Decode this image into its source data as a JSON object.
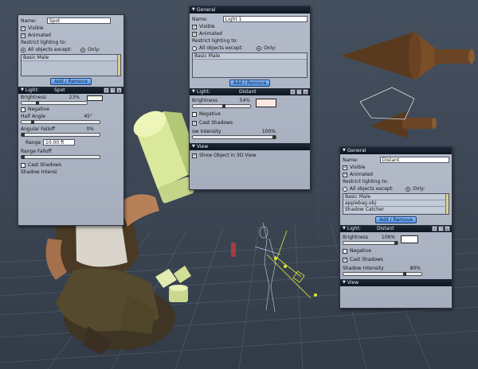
{
  "viewport": {
    "background": "#3e4856"
  },
  "spot_panel": {
    "name_label": "Name:",
    "name_value": "Spot",
    "visible_label": "Visible",
    "animated_label": "Animated",
    "restrict_label": "Restrict lighting to:",
    "all_except_label": "All objects except:",
    "only_label": "Only:",
    "list_items": [
      "Basic Male"
    ],
    "add_remove_label": "Add / Remove",
    "light_header_label": "Light:",
    "light_type": "Spot",
    "brightness_label": "Brightness",
    "brightness_value": "23%",
    "brightness_fraction": 0.23,
    "negative_label": "Negative",
    "half_angle_label": "Half Angle",
    "half_angle_value": "45°",
    "angular_falloff_label": "Angular Falloff",
    "angular_falloff_value": "0%",
    "range_label": "Range",
    "range_value": "10.00 ft",
    "range_falloff_label": "Range Falloff",
    "cast_shadows_label": "Cast Shadows",
    "shadow_intensity_label": "Shadow Intensi",
    "swatch_color": "#f0f5e6"
  },
  "light1_panel": {
    "general_label": "General",
    "name_label": "Name:",
    "name_value": "Light 1",
    "visible_label": "Visible",
    "animated_label": "Animated",
    "restrict_label": "Restrict lighting to:",
    "all_except_label": "All objects except:",
    "only_label": "Only:",
    "list_items": [
      "Basic Male"
    ],
    "add_remove_label": "Add / Remove",
    "light_header_label": "Light:",
    "light_type": "Distant",
    "brightness_label": "Brightness",
    "brightness_value": "54%",
    "brightness_fraction": 0.54,
    "negative_label": "Negative",
    "cast_shadows_label": "Cast Shadows",
    "shadow_intensity_label": "ow Intensity",
    "shadow_intensity_value": "100%",
    "shadow_fraction": 1.0,
    "view_label": "View",
    "show_object_label": "Show Object in 3D View",
    "swatch_color": "#fbe8e4"
  },
  "distant_panel": {
    "general_label": "General",
    "name_label": "Name:",
    "name_value": "Distant",
    "visible_label": "Visible",
    "animated_label": "Animated",
    "restrict_label": "Restrict lighting to:",
    "all_except_label": "All objects except:",
    "only_label": "Only:",
    "list_items": [
      "Basic Male",
      "applebag.obj",
      "Shadow Catcher"
    ],
    "add_remove_label": "Add / Remove",
    "light_header_label": "Light:",
    "light_type": "Distant",
    "brightness_label": "Brightness",
    "brightness_value": "106%",
    "brightness_fraction": 1.0,
    "negative_label": "Negative",
    "cast_shadows_label": "Cast Shadows",
    "shadow_intensity_label": "Shadow Intensity",
    "shadow_intensity_value": "80%",
    "shadow_fraction": 0.8,
    "view_label": "View",
    "swatch_color": "#ffffff"
  }
}
